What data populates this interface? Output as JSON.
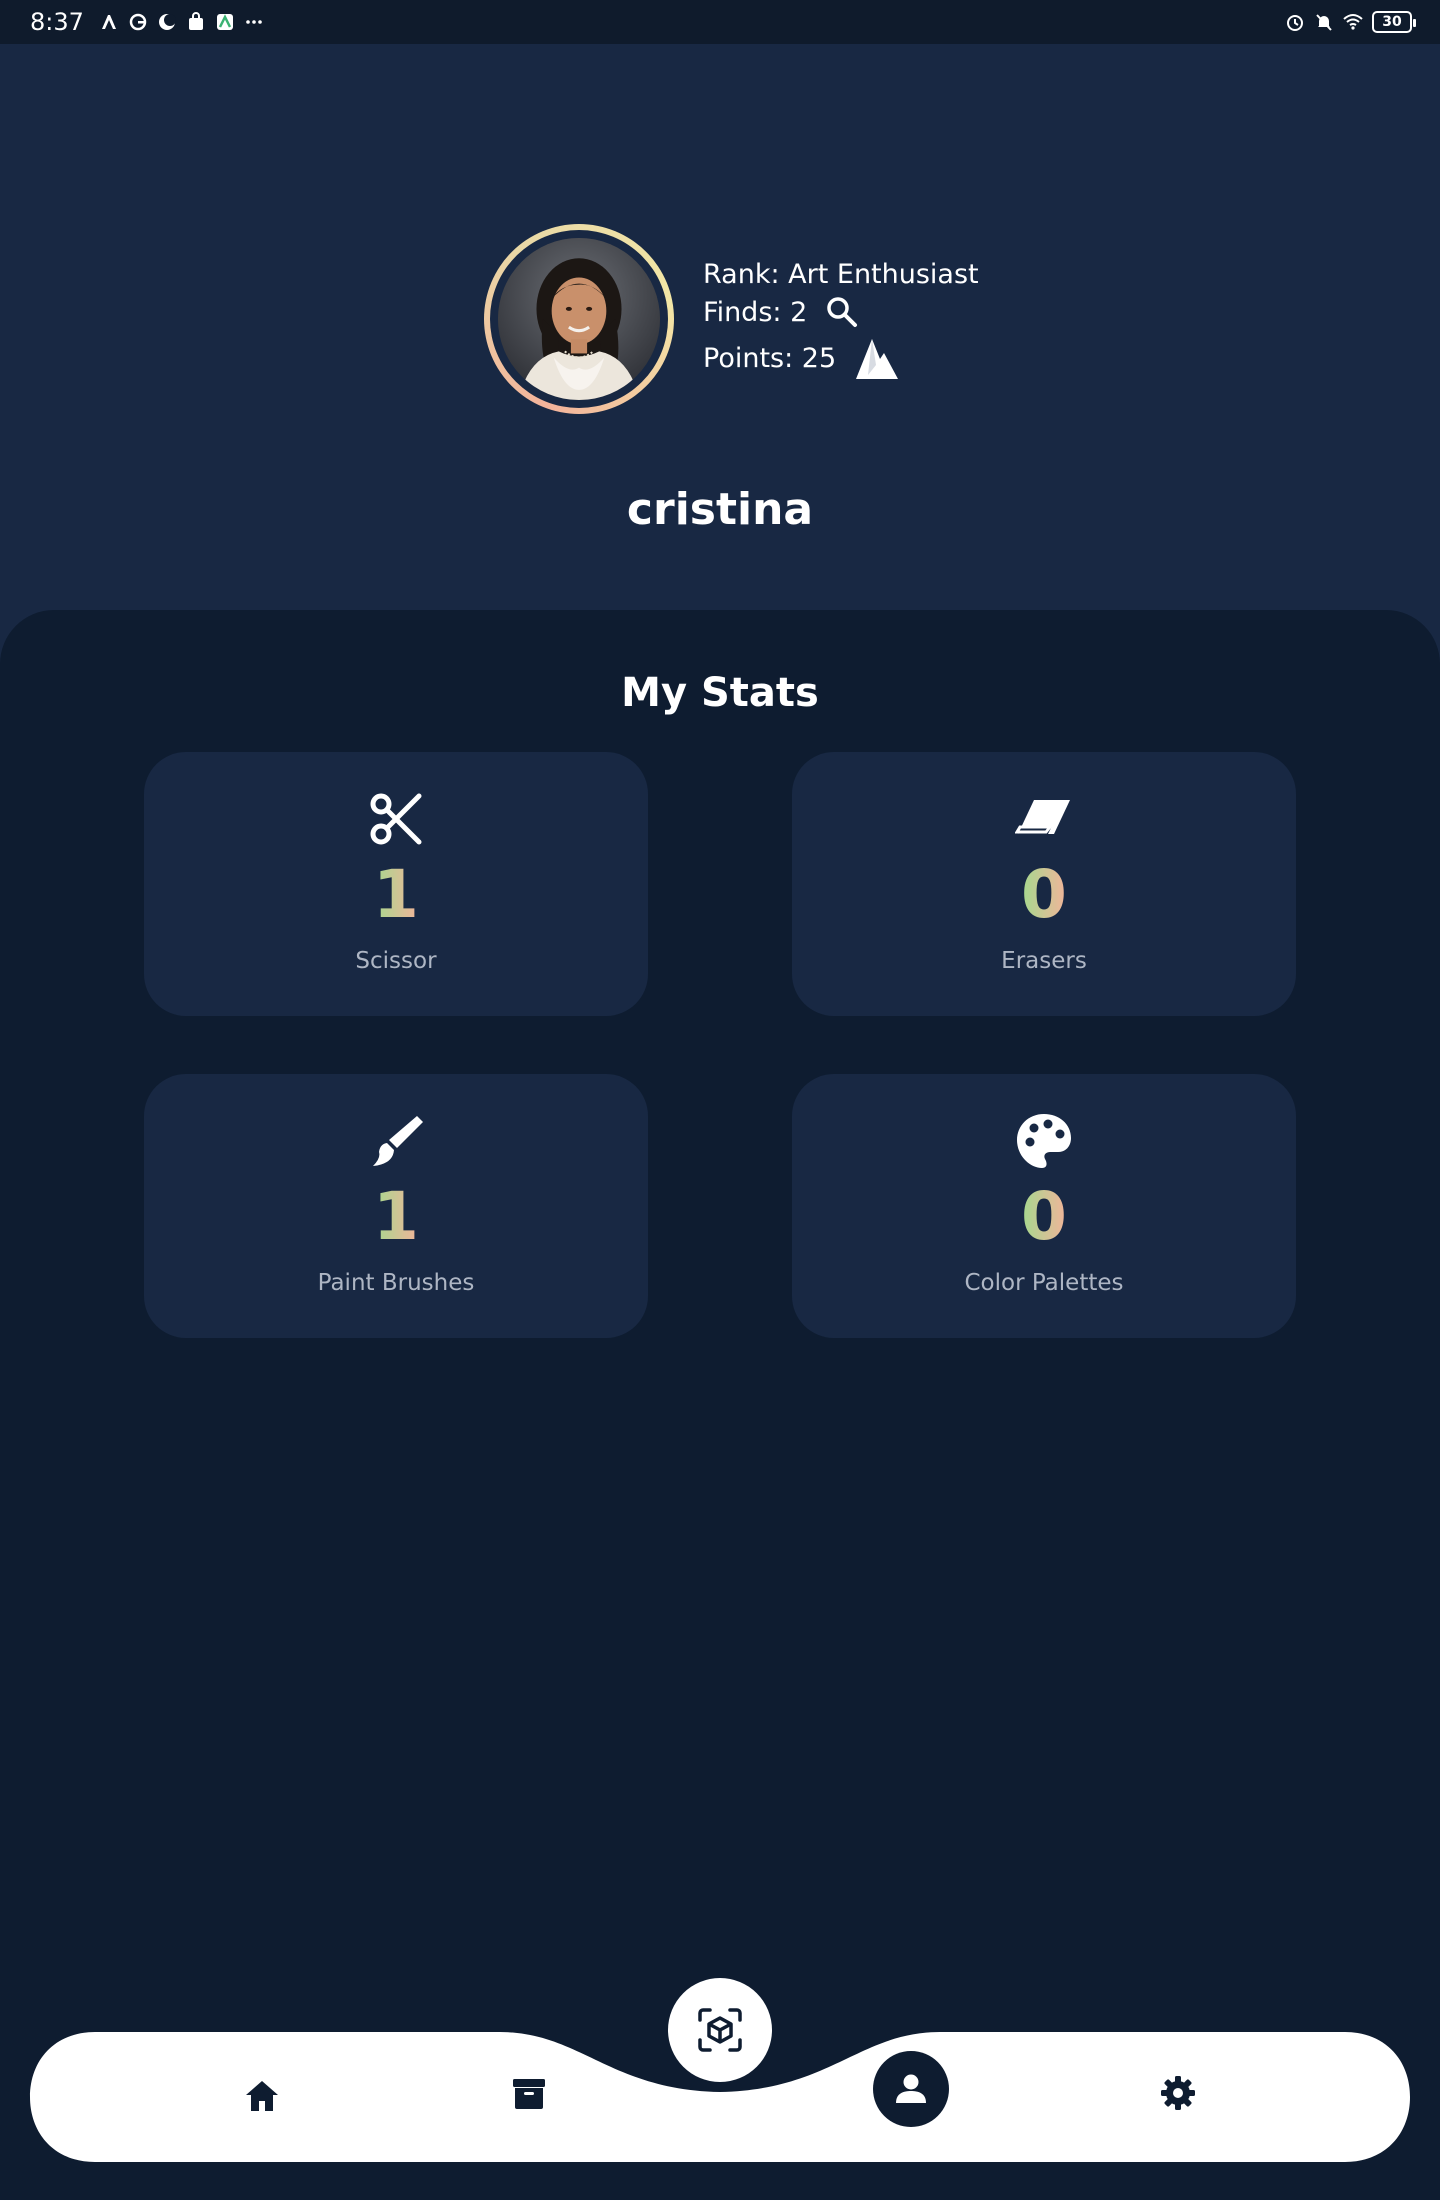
{
  "status_bar": {
    "time": "8:37",
    "left_icons": [
      "maps-icon",
      "google-icon",
      "crescent-icon",
      "shop-bag-icon",
      "app-icon",
      "more-dots-icon"
    ],
    "right_icons": [
      "alarm-icon",
      "bell-muted-icon",
      "wifi-icon"
    ],
    "battery": "30"
  },
  "profile": {
    "rank_text": "Rank: Art Enthusiast",
    "finds_text": "Finds: 2",
    "points_text": "Points: 25",
    "username": "cristina"
  },
  "stats": {
    "title": "My Stats",
    "items": [
      {
        "icon": "scissors-icon",
        "value": "1",
        "label": "Scissor"
      },
      {
        "icon": "eraser-icon",
        "value": "0",
        "label": "Erasers"
      },
      {
        "icon": "paint-brush-icon",
        "value": "1",
        "label": "Paint Brushes"
      },
      {
        "icon": "palette-icon",
        "value": "0",
        "label": "Color Palettes"
      }
    ],
    "value_gradient": [
      "#a4d98e",
      "#f2b49a"
    ]
  },
  "nav": {
    "items": [
      "home-icon",
      "archive-icon",
      "scan-cube-icon",
      "profile-icon",
      "settings-icon"
    ],
    "active": "profile-icon"
  },
  "colors": {
    "background": "#0e1c30",
    "header": "#182843",
    "card": "#182843",
    "nav_bar": "#ffffff"
  }
}
